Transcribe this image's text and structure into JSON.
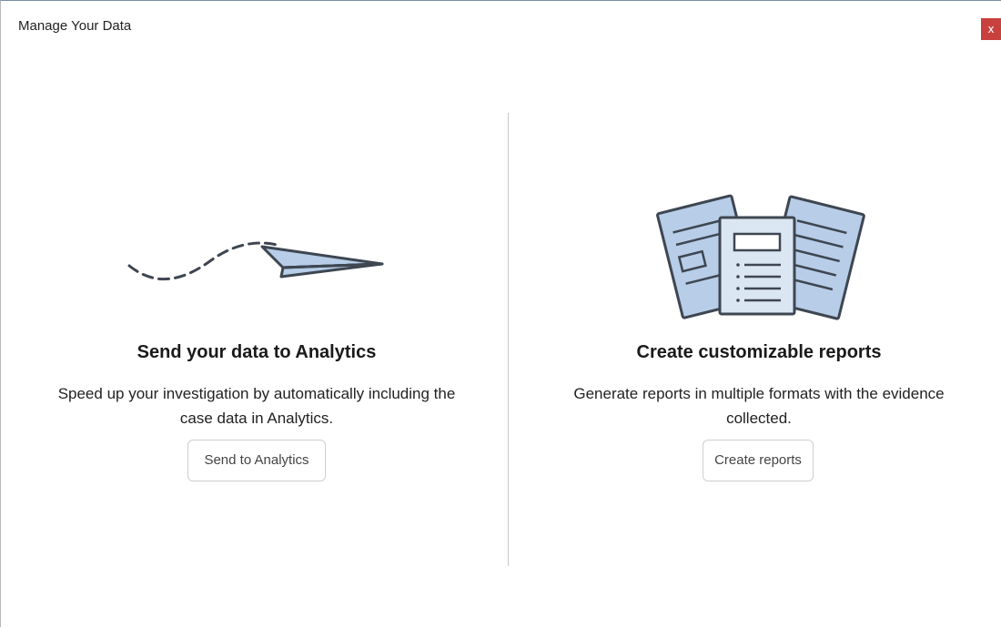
{
  "window": {
    "title": "Manage Your Data",
    "close_label": "x"
  },
  "panels": [
    {
      "illustration": "paper-plane-icon",
      "heading": "Send your data to Analytics",
      "description": "Speed up your investigation by automatically including the case data in Analytics.",
      "button_label": "Send to Analytics"
    },
    {
      "illustration": "documents-icon",
      "heading": "Create customizable reports",
      "description": "Generate reports in multiple formats with the evidence collected.",
      "button_label": "Create reports"
    }
  ],
  "colors": {
    "illustration_fill": "#b7cde8",
    "illustration_stroke": "#3e4651",
    "close_button": "#c9413f"
  }
}
